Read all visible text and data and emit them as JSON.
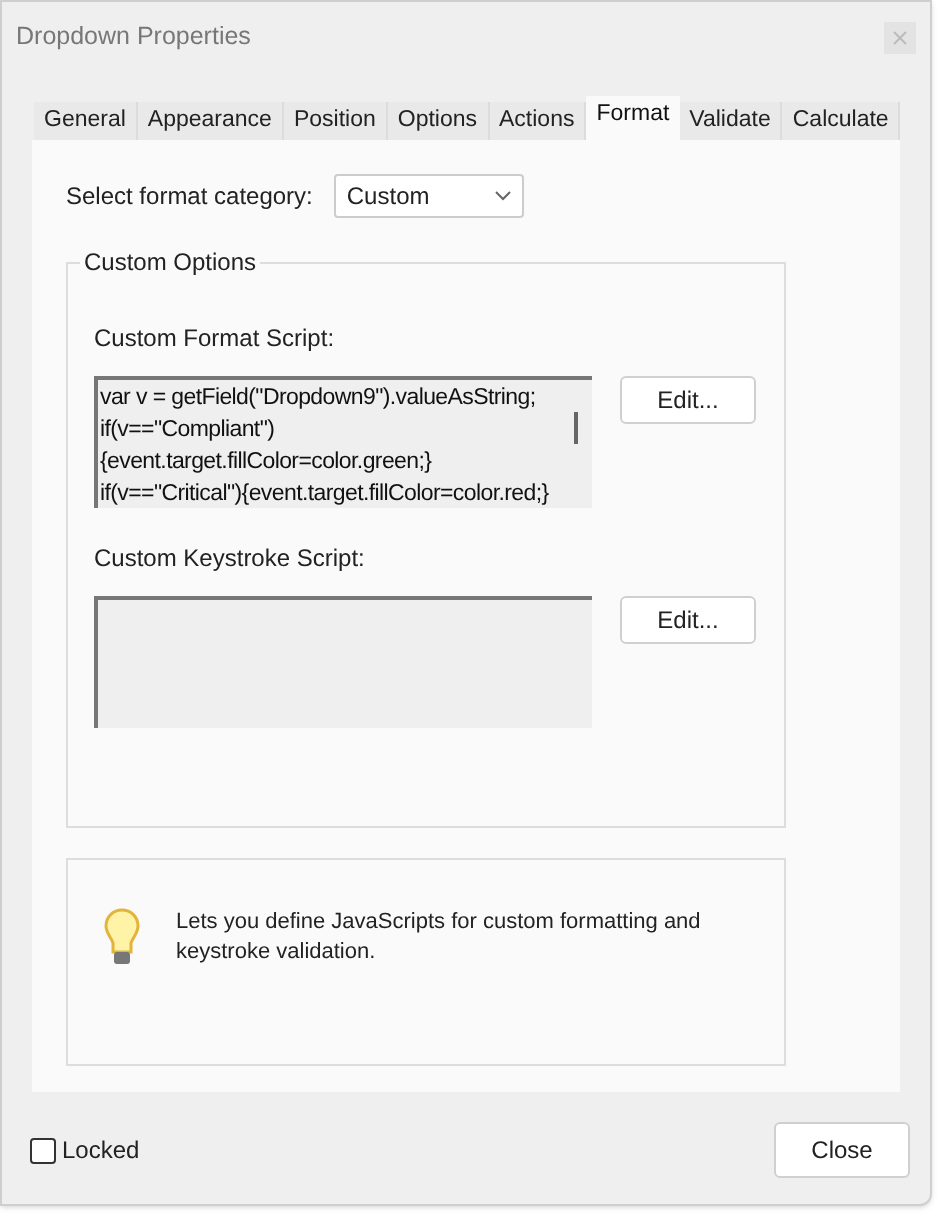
{
  "window": {
    "title": "Dropdown Properties"
  },
  "tabs": [
    {
      "label": "General",
      "selected": false
    },
    {
      "label": "Appearance",
      "selected": false
    },
    {
      "label": "Position",
      "selected": false
    },
    {
      "label": "Options",
      "selected": false
    },
    {
      "label": "Actions",
      "selected": false
    },
    {
      "label": "Format",
      "selected": true
    },
    {
      "label": "Validate",
      "selected": false
    },
    {
      "label": "Calculate",
      "selected": false
    }
  ],
  "format_category": {
    "label": "Select format category:",
    "value": "Custom"
  },
  "custom_options": {
    "title": "Custom Options",
    "format_script": {
      "label": "Custom Format Script:",
      "lines": [
        "var v = getField(\"Dropdown9\").valueAsString;",
        "if(v==\"Compliant\")",
        "{event.target.fillColor=color.green;}",
        "if(v==\"Critical\"){event.target.fillColor=color.red;}"
      ],
      "button": "Edit..."
    },
    "keystroke_script": {
      "label": "Custom Keystroke Script:",
      "button": "Edit..."
    }
  },
  "hint": {
    "text": "Lets you define JavaScripts for custom formatting and keystroke validation."
  },
  "locked": {
    "label": "Locked",
    "checked": false
  },
  "buttons": [
    "Close"
  ]
}
